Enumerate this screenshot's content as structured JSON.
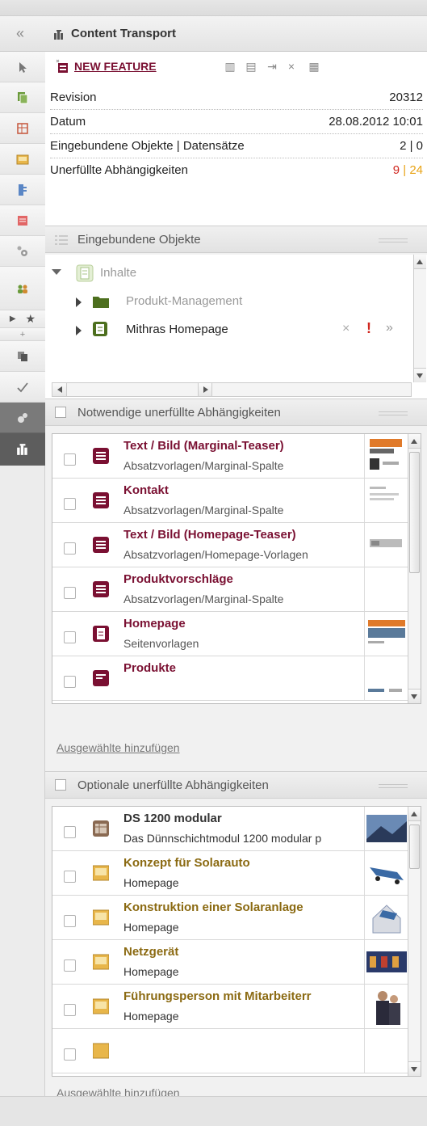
{
  "header": {
    "collapse_icon": "double-chevron-left-icon",
    "title": "Content Transport"
  },
  "sidebar": {
    "items": [
      "pointer-icon",
      "pages-icon",
      "table-icon",
      "media-icon",
      "content-list-icon",
      "report-icon",
      "settings-icon",
      "users-icon",
      "bookmark-star-icon",
      "copy-icon",
      "check-icon",
      "plugin-icon",
      "transport-icon"
    ]
  },
  "feature": {
    "name": "NEW FEATURE",
    "properties": [
      {
        "label": "Revision",
        "value": "20312"
      },
      {
        "label": "Datum",
        "value": "28.08.2012 10:01"
      },
      {
        "label": "Eingebundene Objekte | Datensätze",
        "value": "2 | 0"
      }
    ],
    "unmet": {
      "label": "Unerfüllte Abhängigkeiten",
      "required": "9",
      "separator": "|",
      "optional": "24",
      "required_color": "#d0271f",
      "optional_color": "#e8a315"
    }
  },
  "embedded": {
    "header": "Eingebundene Objekte",
    "tree": {
      "root": "Inhalte",
      "children": [
        "Produkt-Management",
        "Mithras Homepage"
      ]
    },
    "actions": {
      "remove": "×",
      "warning": "!",
      "more": "»"
    }
  },
  "required_section": {
    "header": "Notwendige unerfüllte Abhängigkeiten",
    "items": [
      {
        "title": "Text / Bild (Marginal-Teaser)",
        "path": "Absatzvorlagen/Marginal-Spalte"
      },
      {
        "title": "Kontakt",
        "path": "Absatzvorlagen/Marginal-Spalte"
      },
      {
        "title": "Text / Bild (Homepage-Teaser)",
        "path": "Absatzvorlagen/Homepage-Vorlagen"
      },
      {
        "title": "Produktvorschläge",
        "path": "Absatzvorlagen/Marginal-Spalte"
      },
      {
        "title": "Homepage",
        "path": "Seitenvorlagen"
      },
      {
        "title": "Produkte",
        "path": ""
      }
    ],
    "add_link": "Ausgewählte hinzufügen"
  },
  "optional_section": {
    "header": "Optionale unerfüllte Abhängigkeiten",
    "items": [
      {
        "title": "DS 1200 modular",
        "path": "Das Dünnschichtmodul 1200 modular p"
      },
      {
        "title": "Konzept für Solarauto",
        "path": "Homepage"
      },
      {
        "title": "Konstruktion einer Solaranlage",
        "path": "Homepage"
      },
      {
        "title": "Netzgerät",
        "path": "Homepage"
      },
      {
        "title": "Führungsperson mit Mitarbeiterr",
        "path": "Homepage"
      },
      {
        "title": "",
        "path": ""
      }
    ],
    "add_link": "Ausgewählte hinzufügen"
  }
}
